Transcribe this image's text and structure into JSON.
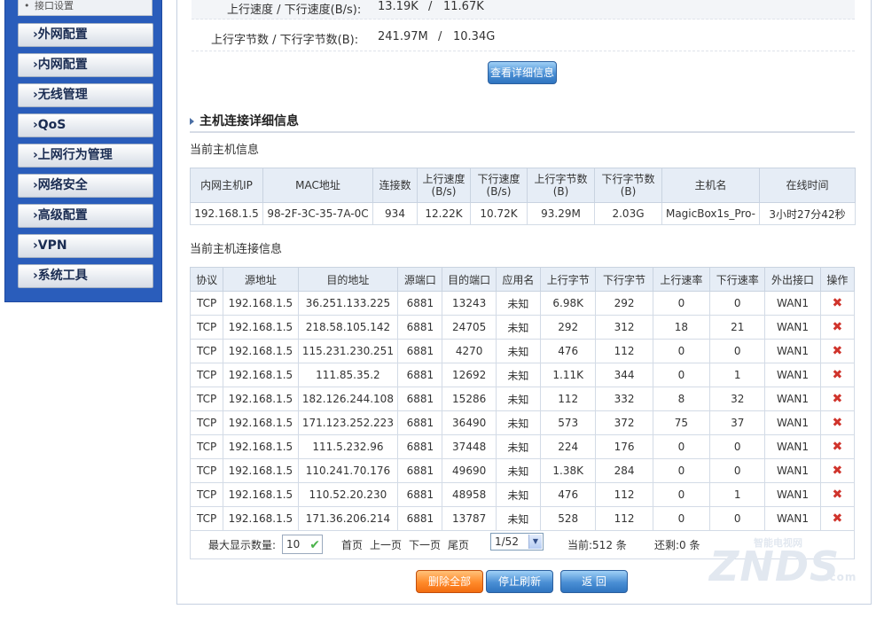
{
  "sidebar": {
    "sub_item": "接口设置",
    "items": [
      {
        "label": "›外网配置"
      },
      {
        "label": "›内网配置"
      },
      {
        "label": "›无线管理"
      },
      {
        "label": "›QoS"
      },
      {
        "label": "›上网行为管理"
      },
      {
        "label": "›网络安全"
      },
      {
        "label": "›高级配置"
      },
      {
        "label": "›VPN"
      },
      {
        "label": "›系统工具"
      }
    ]
  },
  "stats": {
    "speed_label": "上行速度 / 下行速度(B/s):",
    "up_speed": "13.19K",
    "sep": "/",
    "down_speed": "11.67K",
    "bytes_label": "上行字节数 / 下行字节数(B):",
    "up_bytes": "241.97M",
    "down_bytes": "10.34G",
    "detail_button": "查看详细信息"
  },
  "section": {
    "title": "主机连接详细信息",
    "host_info_title": "当前主机信息",
    "conn_info_title": "当前主机连接信息"
  },
  "host_table": {
    "headers": [
      "内网主机IP",
      "MAC地址",
      "连接数",
      "上行速度\n(B/s)",
      "下行速度\n(B/s)",
      "上行字节数\n(B)",
      "下行字节数\n(B)",
      "主机名",
      "在线时间"
    ],
    "row": [
      "192.168.1.5",
      "98-2F-3C-35-7A-0C",
      "934",
      "12.22K",
      "10.72K",
      "93.29M",
      "2.03G",
      "MagicBox1s_Pro-",
      "3小时27分42秒"
    ]
  },
  "conn_table": {
    "headers": [
      "协议",
      "源地址",
      "目的地址",
      "源端口",
      "目的端口",
      "应用名",
      "上行字节",
      "下行字节",
      "上行速率",
      "下行速率",
      "外出接口",
      "操作"
    ],
    "rows": [
      [
        "TCP",
        "192.168.1.5",
        "36.251.133.225",
        "6881",
        "13243",
        "未知",
        "6.98K",
        "292",
        "0",
        "0",
        "WAN1"
      ],
      [
        "TCP",
        "192.168.1.5",
        "218.58.105.142",
        "6881",
        "24705",
        "未知",
        "292",
        "312",
        "18",
        "21",
        "WAN1"
      ],
      [
        "TCP",
        "192.168.1.5",
        "115.231.230.251",
        "6881",
        "4270",
        "未知",
        "476",
        "112",
        "0",
        "0",
        "WAN1"
      ],
      [
        "TCP",
        "192.168.1.5",
        "111.85.35.2",
        "6881",
        "12692",
        "未知",
        "1.11K",
        "344",
        "0",
        "1",
        "WAN1"
      ],
      [
        "TCP",
        "192.168.1.5",
        "182.126.244.108",
        "6881",
        "15286",
        "未知",
        "112",
        "332",
        "8",
        "32",
        "WAN1"
      ],
      [
        "TCP",
        "192.168.1.5",
        "171.123.252.223",
        "6881",
        "36490",
        "未知",
        "573",
        "372",
        "75",
        "37",
        "WAN1"
      ],
      [
        "TCP",
        "192.168.1.5",
        "111.5.232.96",
        "6881",
        "37448",
        "未知",
        "224",
        "176",
        "0",
        "0",
        "WAN1"
      ],
      [
        "TCP",
        "192.168.1.5",
        "110.241.70.176",
        "6881",
        "49690",
        "未知",
        "1.38K",
        "284",
        "0",
        "0",
        "WAN1"
      ],
      [
        "TCP",
        "192.168.1.5",
        "110.52.20.230",
        "6881",
        "48958",
        "未知",
        "476",
        "112",
        "0",
        "1",
        "WAN1"
      ],
      [
        "TCP",
        "192.168.1.5",
        "171.36.206.214",
        "6881",
        "13787",
        "未知",
        "528",
        "112",
        "0",
        "0",
        "WAN1"
      ]
    ],
    "delete_glyph": "✖"
  },
  "pager": {
    "max_label": "最大显示数量:",
    "max_value": "10",
    "first": "首页",
    "prev": "上一页",
    "next": "下一页",
    "last": "尾页",
    "page_select": "1/52",
    "current": "当前:512 条",
    "remaining": "还剩:0 条"
  },
  "actions": {
    "delete_all": "删除全部",
    "stop_refresh": "停止刷新",
    "back": "返 回"
  },
  "watermark": {
    "small": "智能电视网",
    "big": "ZNDS",
    "dotcom": ".com"
  },
  "colors": {
    "sidebar_bg": "#2a5dbb",
    "delete_icon": "#d0342c",
    "button_blue": "#4a8fd4",
    "button_orange": "#ff8a2a"
  },
  "icons": {
    "delete": "delete-x-icon",
    "confirm": "check-icon",
    "section_marker": "triangle-right-icon"
  }
}
